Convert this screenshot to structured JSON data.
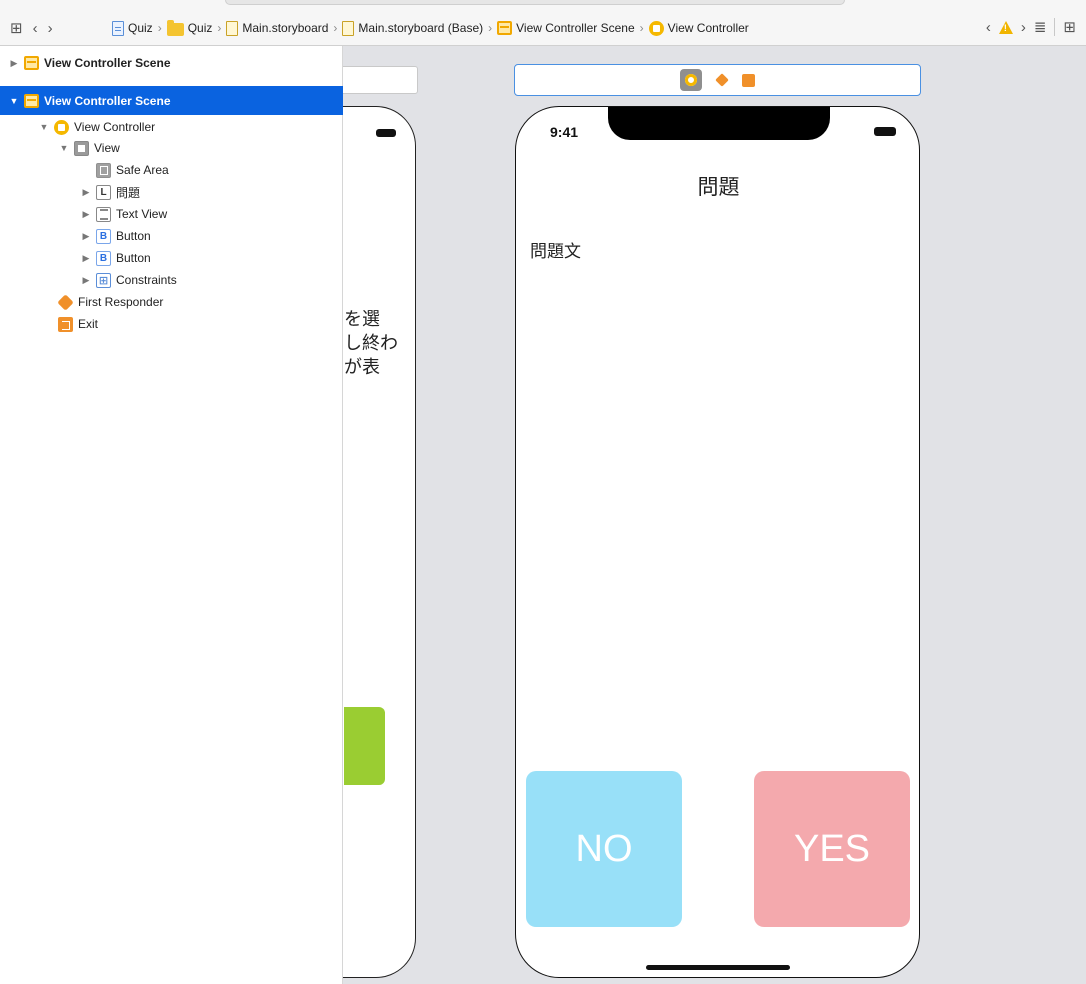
{
  "jumpbar": {
    "breadcrumbs": [
      {
        "label": "Quiz",
        "icon": "project-file-icon"
      },
      {
        "label": "Quiz",
        "icon": "folder-icon"
      },
      {
        "label": "Main.storyboard",
        "icon": "storyboard-file-icon"
      },
      {
        "label": "Main.storyboard (Base)",
        "icon": "storyboard-file-icon"
      },
      {
        "label": "View Controller Scene",
        "icon": "scene-icon"
      },
      {
        "label": "View Controller",
        "icon": "view-controller-icon"
      }
    ],
    "warning_color": "#f1b500"
  },
  "outline": {
    "rows": [
      {
        "label": "View Controller Scene",
        "expanded": false
      },
      {
        "label": "View Controller Scene",
        "expanded": true,
        "selected": true
      },
      {
        "label": "View Controller"
      },
      {
        "label": "View"
      },
      {
        "label": "Safe Area"
      },
      {
        "label": "問題",
        "badge": "L"
      },
      {
        "label": "Text View"
      },
      {
        "label": "Button",
        "badge": "B"
      },
      {
        "label": "Button",
        "badge": "B"
      },
      {
        "label": "Constraints",
        "badge": "⊞"
      },
      {
        "label": "First Responder"
      },
      {
        "label": "Exit"
      }
    ],
    "selection_color": "#0a63e0"
  },
  "canvas": {
    "ghost_text": [
      "を選",
      "し終わ",
      "が表"
    ],
    "phone": {
      "time": "9:41",
      "title": "問題",
      "question_text": "問題文",
      "no_label": "NO",
      "yes_label": "YES",
      "no_color": "#98e0f8",
      "yes_color": "#f4a9ad"
    }
  }
}
